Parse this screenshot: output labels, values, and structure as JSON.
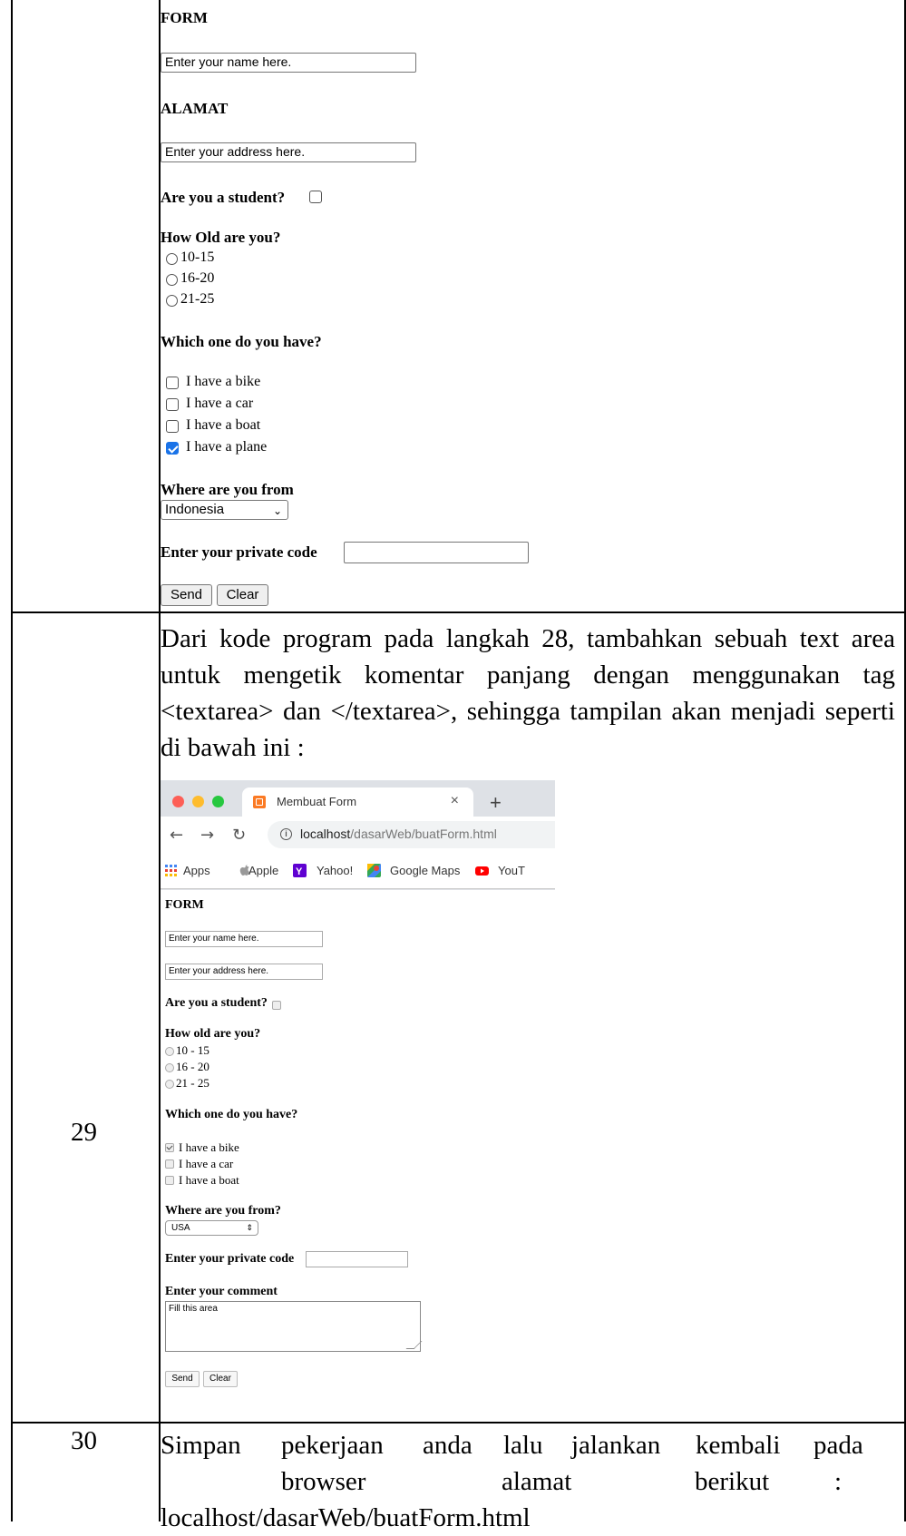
{
  "row_top": {
    "form_heading": "FORM",
    "name_placeholder": "Enter your name here.",
    "address_heading": "ALAMAT",
    "address_placeholder": "Enter your address here.",
    "student_label": "Are you a student?",
    "age_heading": "How Old are you?",
    "age_options": [
      "10-15",
      "16-20",
      "21-25"
    ],
    "have_heading": "Which one do you have?",
    "have_options": [
      "I have a bike",
      "I have a car",
      "I have a boat",
      "I have a plane"
    ],
    "have_checked": [
      false,
      false,
      false,
      true
    ],
    "from_heading": "Where are you from",
    "from_selected": "Indonesia",
    "code_label": "Enter your private code",
    "send_label": "Send",
    "clear_label": "Clear"
  },
  "row29": {
    "number": "29",
    "instruction": "Dari kode program pada langkah 28, tambahkan sebuah text area untuk mengetik komentar panjang dengan menggunakan tag <textarea> dan </textarea>, sehingga tampilan akan menjadi seperti di bawah ini :",
    "browser": {
      "tab_title": "Membuat Form",
      "tab_close": "×",
      "new_tab": "+",
      "url_host": "localhost",
      "url_path": "/dasarWeb/buatForm.html",
      "bookmarks": [
        "Apps",
        "Apple",
        "Yahoo!",
        "Google Maps",
        "YouT"
      ],
      "form_heading": "FORM",
      "name_placeholder": "Enter your name here.",
      "address_placeholder": "Enter your address here.",
      "student_label": "Are you a student?",
      "age_heading": "How old are you?",
      "age_options": [
        "10 - 15",
        "16 - 20",
        "21 - 25"
      ],
      "have_heading": "Which one do you have?",
      "have_options": [
        "I have a bike",
        "I have a car",
        "I have a boat"
      ],
      "have_checked": [
        true,
        false,
        false
      ],
      "from_heading": "Where are you from?",
      "from_selected": "USA",
      "code_label": "Enter your private code",
      "comment_heading": "Enter your comment",
      "comment_placeholder": "Fill this area",
      "send_label": "Send",
      "clear_label": "Clear"
    }
  },
  "row30": {
    "number": "30",
    "words_line1": [
      "Simpan",
      "pekerjaan",
      "anda",
      "lalu",
      "jalankan",
      "kembali",
      "pada"
    ],
    "words_line2": [
      "browser",
      "alamat",
      "berikut",
      ":"
    ],
    "line3": "localhost/dasarWeb/buatForm.html"
  }
}
